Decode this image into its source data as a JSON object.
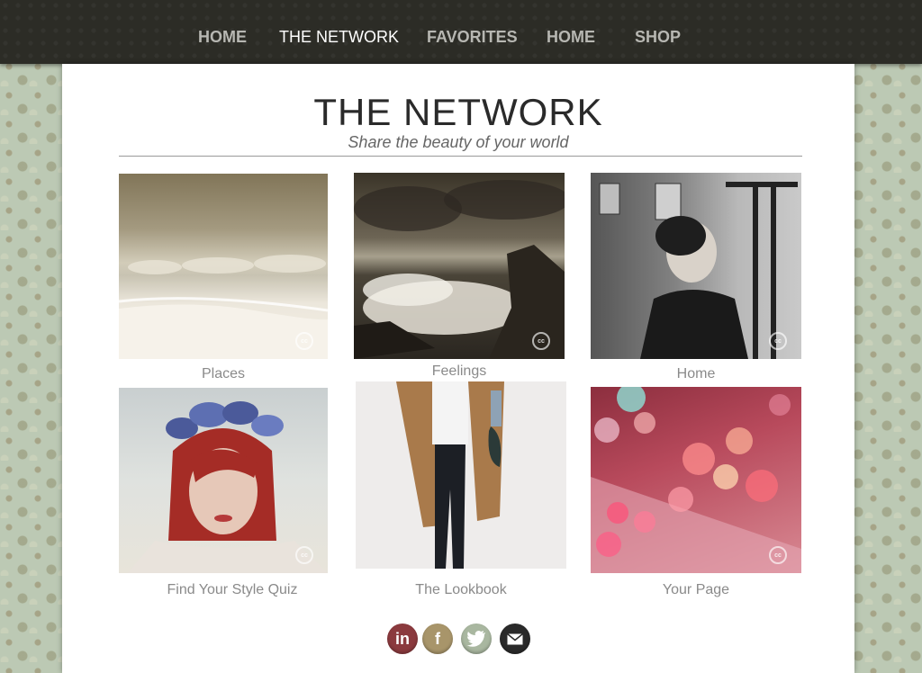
{
  "nav": [
    {
      "label": "HOME",
      "active": false
    },
    {
      "label": "THE NETWORK",
      "active": true
    },
    {
      "label": "FAVORITES",
      "active": false
    },
    {
      "label": "HOME",
      "active": false
    },
    {
      "label": "SHOP",
      "active": false
    }
  ],
  "page": {
    "title": "THE NETWORK",
    "subtitle": "Share the beauty of your world"
  },
  "tiles": [
    {
      "caption": "Places",
      "image": "beach-photo"
    },
    {
      "caption": "Feelings",
      "image": "stormy-sea-photo"
    },
    {
      "caption": "Home",
      "image": "woman-cafe-photo"
    },
    {
      "caption": "Find Your Style Quiz",
      "image": "flower-crown-portrait"
    },
    {
      "caption": "The Lookbook",
      "image": "camel-coat-outfit-photo"
    },
    {
      "caption": "Your Page",
      "image": "pink-bokeh-photo"
    }
  ],
  "cc_badge": "cc",
  "social": [
    {
      "icon": "linkedin-icon",
      "glyph": "in",
      "color": "#8b3a3e"
    },
    {
      "icon": "facebook-icon",
      "glyph": "f",
      "color": "#a8956a"
    },
    {
      "icon": "twitter-icon",
      "glyph": "",
      "color": "#a9b7a0"
    },
    {
      "icon": "email-icon",
      "glyph": "",
      "color": "#2a2a2a"
    }
  ]
}
